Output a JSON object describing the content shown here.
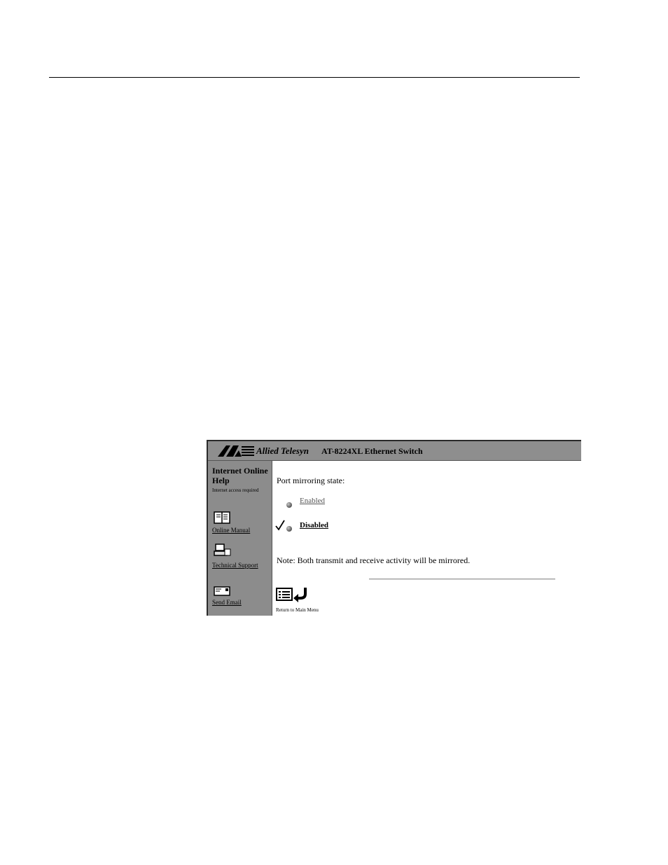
{
  "banner": {
    "brand": "Allied Telesyn",
    "product": "AT-8224XL Ethernet Switch"
  },
  "sidebar": {
    "help_title": "Internet Online Help",
    "help_note": "Internet access required",
    "links": [
      {
        "label": "Online Manual",
        "icon": "book-icon"
      },
      {
        "label": "Technical Support",
        "icon": "support-icon"
      },
      {
        "label": "Send Email",
        "icon": "envelope-icon"
      }
    ]
  },
  "main": {
    "label": "Port mirroring state:",
    "options": [
      {
        "label": "Enabled",
        "selected": false
      },
      {
        "label": "Disabled",
        "selected": true
      }
    ],
    "note": "Note: Both transmit and receive activity will be mirrored.",
    "return_label": "Return to Main Menu"
  }
}
